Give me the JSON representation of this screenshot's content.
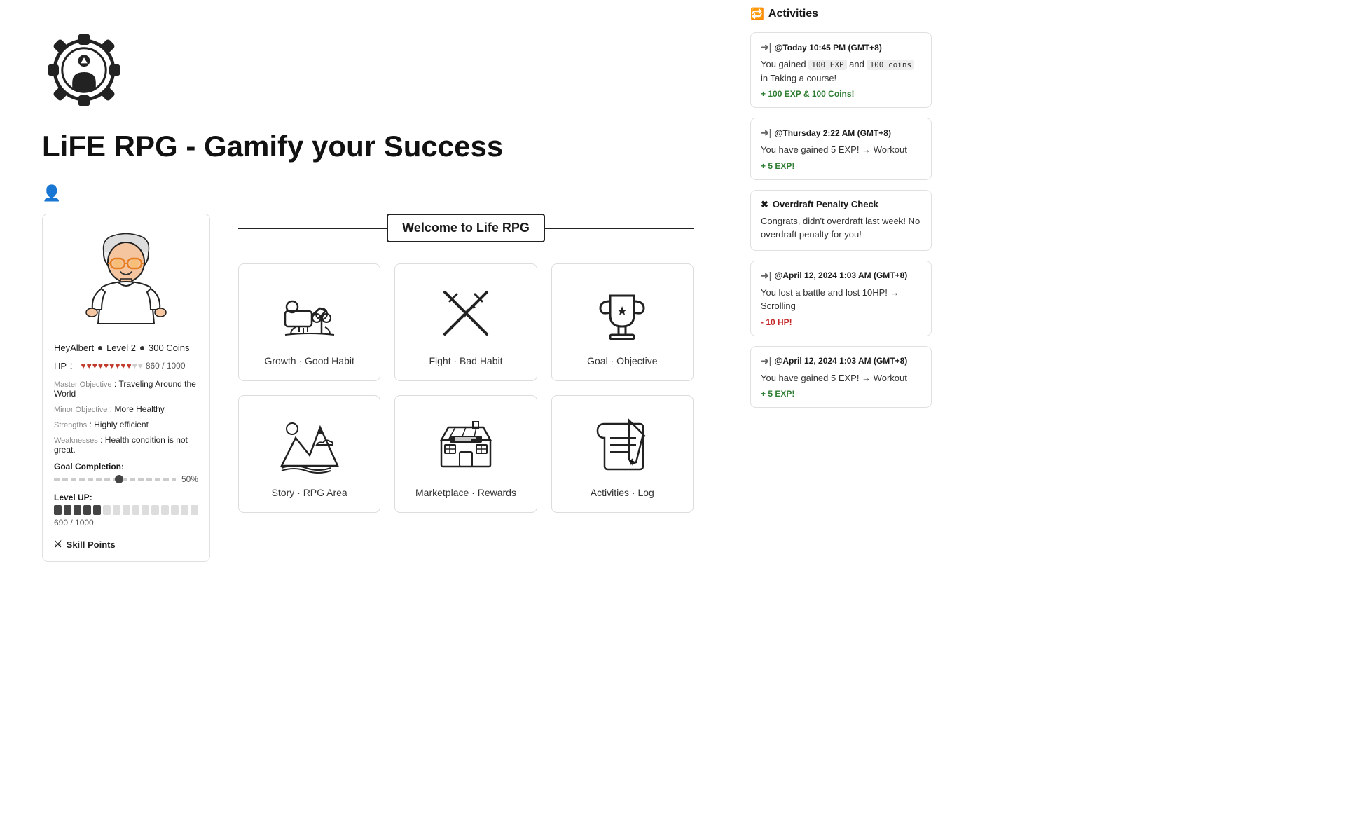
{
  "app": {
    "title": "LiFE RPG - Gamify your Success",
    "activities_title": "Activities"
  },
  "character": {
    "name": "HeyAlbert",
    "level": "Level 2",
    "coins": "300 Coins",
    "hp_current": 860,
    "hp_max": 1000,
    "hp_label": "HP ：",
    "hearts_filled": 9,
    "hearts_empty": 2,
    "master_objective_label": "Master Objective",
    "master_objective_value": "Traveling Around the World",
    "minor_objective_label": "Minor Objective",
    "minor_objective_value": "More Healthy",
    "strengths_label": "Strengths",
    "strengths_value": "Highly efficient",
    "weaknesses_label": "Weaknesses",
    "weaknesses_value": "Health condition is not great.",
    "goal_completion_label": "Goal Completion:",
    "goal_pct": "50%",
    "level_up_label": "Level UP:",
    "level_value": "690 / 1000",
    "level_filled": 5,
    "level_empty": 10,
    "skill_points_label": "Skill Points"
  },
  "welcome_banner": "Welcome to Life RPG",
  "cards": [
    {
      "id": "growth-good-habit",
      "label": "Growth · Good Habit",
      "icon": "plant"
    },
    {
      "id": "fight-bad-habit",
      "label": "Fight · Bad Habit",
      "icon": "swords"
    },
    {
      "id": "goal-objective",
      "label": "Goal · Objective",
      "icon": "trophy"
    },
    {
      "id": "story",
      "label": "Story · RPG Area",
      "icon": "mountain"
    },
    {
      "id": "marketplace",
      "label": "Marketplace · Rewards",
      "icon": "shop"
    },
    {
      "id": "activities",
      "label": "Activities · Log",
      "icon": "pen"
    }
  ],
  "activities": [
    {
      "type": "arrow",
      "timestamp": "@Today 10:45 PM (GMT+8)",
      "text_parts": [
        "You gained ",
        "100 EXP",
        " and ",
        "100 coins",
        " in Taking a course!"
      ],
      "reward": "+ 100 EXP & 100 Coins!",
      "reward_type": "positive"
    },
    {
      "type": "arrow",
      "timestamp": "@Thursday 2:22 AM (GMT+8)",
      "text_parts": [
        "You have gained 5 EXP!  →  Workout"
      ],
      "reward": "+ 5 EXP!",
      "reward_type": "positive"
    },
    {
      "type": "x",
      "title": "Overdraft Penalty Check",
      "text": "Congrats, didn't overdraft last week! No overdraft penalty for you!",
      "reward": null
    },
    {
      "type": "arrow",
      "timestamp": "@April 12, 2024 1:03 AM (GMT+8)",
      "text_parts": [
        "You lost a battle and lost 10HP!  →  Scrolling"
      ],
      "reward": "- 10 HP!",
      "reward_type": "negative"
    },
    {
      "type": "arrow",
      "timestamp": "@April 12, 2024 1:03 AM (GMT+8)",
      "text_parts": [
        "You have gained 5 EXP!  →  Workout"
      ],
      "reward": "+ 5 EXP!",
      "reward_type": "positive"
    }
  ]
}
